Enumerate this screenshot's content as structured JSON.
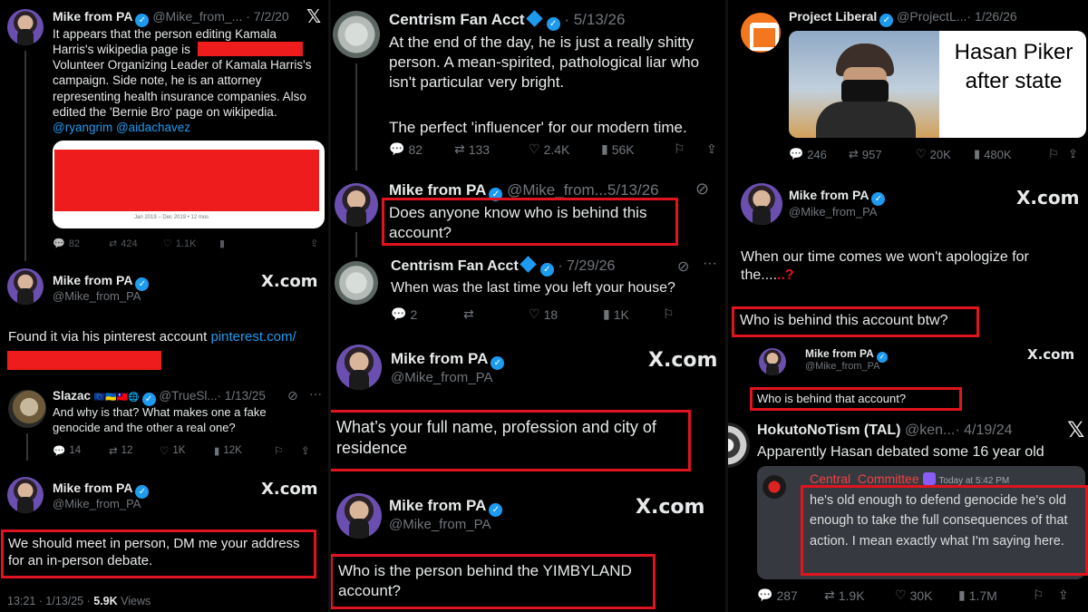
{
  "colors": {
    "link": "#1d9bf0",
    "highlight_box": "#e0141e",
    "muted": "#71767b",
    "text": "#e7e9ea",
    "background": "#000000"
  },
  "left": {
    "tweet1": {
      "name": "Mike from PA",
      "handle": "@Mike_from_...",
      "date": "· 7/2/20",
      "text": "It appears that the person editing Kamala Harris's wikipedia page is",
      "text2": "Volunteer Organizing Leader of Kamala Harris's campaign. Side note, he is an attorney representing health insurance companies. Also edited the 'Bernie Bro' page on wikipedia.",
      "mentions": "@ryangrim @aidachavez",
      "chart_caption": "Jan 2019 – Dec 2019 • 12 mos",
      "actions": {
        "replies": "82",
        "reposts": "424",
        "likes": "1.1K"
      }
    },
    "tweet2": {
      "name": "Mike from PA",
      "handle": "@Mike_from_PA",
      "brand": "X.com",
      "text": "Found it via his pinterest account",
      "link": "pinterest.com/"
    },
    "tweet3": {
      "name": "Slazac",
      "flags": "🇪🇺🇺🇦🇹🇼🌐",
      "handle": "@TrueSl...",
      "date": "· 1/13/25",
      "text": "And why is that? What makes one a fake genocide and the other a real one?",
      "actions": {
        "replies": "14",
        "reposts": "12",
        "likes": "1K",
        "views": "12K"
      }
    },
    "tweet4": {
      "name": "Mike from PA",
      "handle": "@Mike_from_PA",
      "brand": "X.com",
      "text": "We should meet in person, DM me your address for an in-person debate.",
      "time": "13:21 · 1/13/25 ·",
      "views_count": "5.9K",
      "views_label": "Views"
    }
  },
  "middle": {
    "tweet1": {
      "name": "Centrism Fan Acct",
      "date": "· 5/13/26",
      "text": "At the end of the day, he is just a really shitty person. A mean-spirited, pathological liar who isn't particular very bright.",
      "text2": "The perfect 'influencer' for our modern time.",
      "actions": {
        "replies": "82",
        "reposts": "133",
        "likes": "2.4K",
        "views": "56K"
      }
    },
    "tweet2": {
      "name": "Mike from PA",
      "handle": "@Mike_from...",
      "date": "5/13/26",
      "text": "Does anyone know who is behind this account?"
    },
    "tweet3": {
      "name": "Centrism Fan Acct",
      "date": "· 7/29/26",
      "text": "When was the last time you left your house?",
      "actions": {
        "replies": "2",
        "likes": "18",
        "views": "1K"
      }
    },
    "tweet4": {
      "name": "Mike from PA",
      "handle": "@Mike_from_PA",
      "brand": "X.com",
      "text": "What’s your full name, profession and city of residence"
    },
    "tweet5": {
      "name": "Mike from PA",
      "handle": "@Mike_from_PA",
      "brand": "X.com",
      "text": "Who is the person behind the YIMBYLAND account?"
    }
  },
  "right": {
    "tweet1": {
      "name": "Project Liberal",
      "handle": "@ProjectL...",
      "date": "· 1/26/26",
      "image_caption": "Hasan Piker after state",
      "actions": {
        "replies": "246",
        "reposts": "957",
        "likes": "20K",
        "views": "480K"
      }
    },
    "tweet2": {
      "name": "Mike from PA",
      "handle": "@Mike_from_PA",
      "brand": "X.com",
      "text": "When our time comes we won't apologize for the....",
      "dots": "..?"
    },
    "tweet2_box": "Who is behind this account btw?",
    "tweet3": {
      "name": "Mike from PA",
      "handle": "@Mike_from_PA",
      "brand": "X.com",
      "text": "Who is behind that account?"
    },
    "tweet4": {
      "name": "HokutoNoTism (TAL)",
      "handle": "@ken...",
      "date": "· 4/19/24",
      "text": "Apparently Hasan debated some 16 year old",
      "discord_user": "Central_Committee",
      "discord_time": "Today at 5:42 PM",
      "discord_text": "he's old enough to defend genocide he's old enough to take the full consequences of that action. I mean exactly what I'm saying here.",
      "actions": {
        "replies": "287",
        "reposts": "1.9K",
        "likes": "30K",
        "views": "1.7M"
      }
    }
  }
}
